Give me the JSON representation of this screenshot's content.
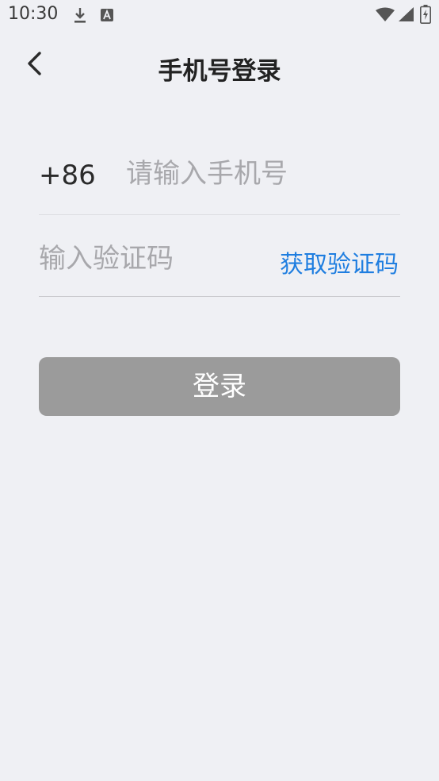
{
  "status_bar": {
    "time": "10:30",
    "icons": [
      "download-icon",
      "font-a-icon",
      "wifi-icon",
      "signal-icon",
      "battery-charging-icon"
    ]
  },
  "header": {
    "title": "手机号登录",
    "back_icon": "chevron-left-icon"
  },
  "form": {
    "country_code": "+86",
    "phone_placeholder": "请输入手机号",
    "code_placeholder": "输入验证码",
    "get_code_label": "获取验证码"
  },
  "login_button": {
    "label": "登录"
  },
  "colors": {
    "background": "#eff0f4",
    "accent": "#1f7ee0",
    "button_disabled": "#9b9b9b",
    "placeholder": "#a8a8ac"
  }
}
